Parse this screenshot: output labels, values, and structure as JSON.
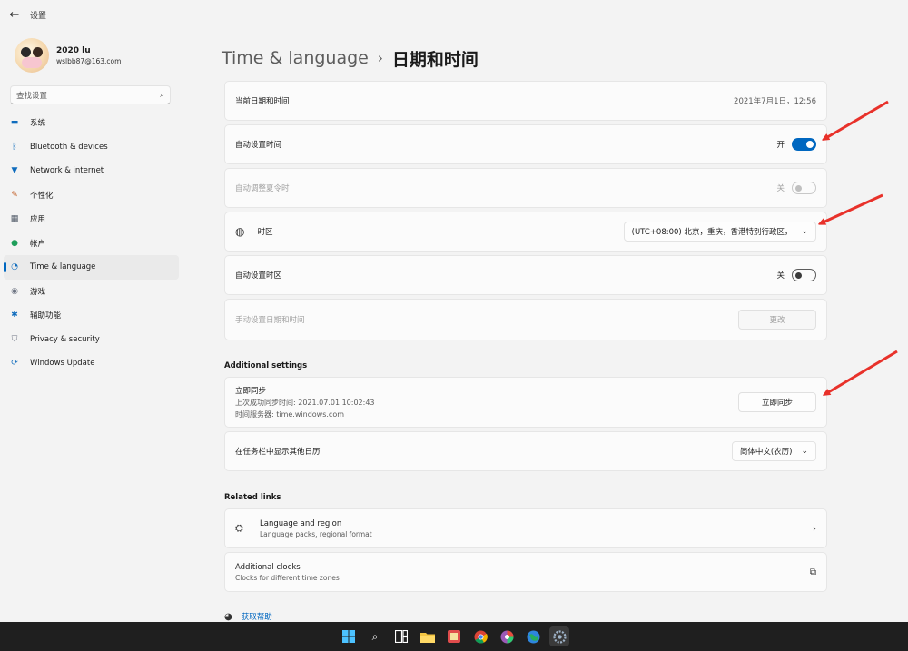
{
  "window": {
    "back_icon": "back-arrow-icon",
    "title": "设置"
  },
  "profile": {
    "name": "2020 lu",
    "email": "wslbb87@163.com"
  },
  "search": {
    "placeholder": "查找设置"
  },
  "sidebar": {
    "items": [
      {
        "label": "系统",
        "icon": "monitor-icon",
        "color": "#0f6cbd"
      },
      {
        "label": "Bluetooth & devices",
        "icon": "bluetooth-icon",
        "color": "#0f6cbd"
      },
      {
        "label": "Network & internet",
        "icon": "wifi-icon",
        "color": "#0f6cbd"
      },
      {
        "label": "个性化",
        "icon": "brush-icon",
        "color": "#c05a20"
      },
      {
        "label": "应用",
        "icon": "apps-icon",
        "color": "#4b5563"
      },
      {
        "label": "帐户",
        "icon": "person-icon",
        "color": "#1e9e5a"
      },
      {
        "label": "Time & language",
        "icon": "globe-clock-icon",
        "color": "#0f6cbd",
        "active": true
      },
      {
        "label": "游戏",
        "icon": "gamepad-icon",
        "color": "#6b7280"
      },
      {
        "label": "辅助功能",
        "icon": "accessibility-icon",
        "color": "#0f6cbd"
      },
      {
        "label": "Privacy & security",
        "icon": "shield-icon",
        "color": "#6b7280"
      },
      {
        "label": "Windows Update",
        "icon": "update-icon",
        "color": "#0f6cbd"
      }
    ]
  },
  "breadcrumb": {
    "parent": "Time & language",
    "separator": "›",
    "current": "日期和时间"
  },
  "settings": {
    "current_datetime": {
      "label": "当前日期和时间",
      "value": "2021年7月1日，12:56"
    },
    "auto_time": {
      "label": "自动设置时间",
      "state_text": "开",
      "on": true
    },
    "auto_dst": {
      "label": "自动调整夏令时",
      "state_text": "关",
      "on": false,
      "disabled": true
    },
    "timezone": {
      "label": "时区",
      "value": "(UTC+08:00) 北京，重庆，香港特别行政区，"
    },
    "auto_timezone": {
      "label": "自动设置时区",
      "state_text": "关",
      "on": false
    },
    "manual_datetime": {
      "label": "手动设置日期和时间",
      "button": "更改",
      "disabled": true
    }
  },
  "additional": {
    "title": "Additional settings",
    "sync": {
      "title": "立即同步",
      "last_sync": "上次成功同步时间: 2021.07.01 10:02:43",
      "server": "时间服务器: time.windows.com",
      "button": "立即同步"
    },
    "calendar": {
      "label": "在任务栏中显示其他日历",
      "value": "简体中文(农历)"
    }
  },
  "related": {
    "title": "Related links",
    "items": [
      {
        "title": "Language and region",
        "subtitle": "Language packs, regional format",
        "icon": "language-icon",
        "action_icon": "chevron-right-icon"
      },
      {
        "title": "Additional clocks",
        "subtitle": "Clocks for different time zones",
        "icon": "",
        "action_icon": "external-link-icon"
      }
    ]
  },
  "help": {
    "label": "获取帮助"
  },
  "taskbar": {
    "icons": [
      "windows-start-icon",
      "search-icon",
      "task-view-icon",
      "file-explorer-icon",
      "app-icon",
      "chrome-icon",
      "color-app-icon",
      "globe-app-icon",
      "settings-icon"
    ]
  },
  "colors": {
    "accent": "#0067c0",
    "annotation_arrow": "#e8312a"
  }
}
